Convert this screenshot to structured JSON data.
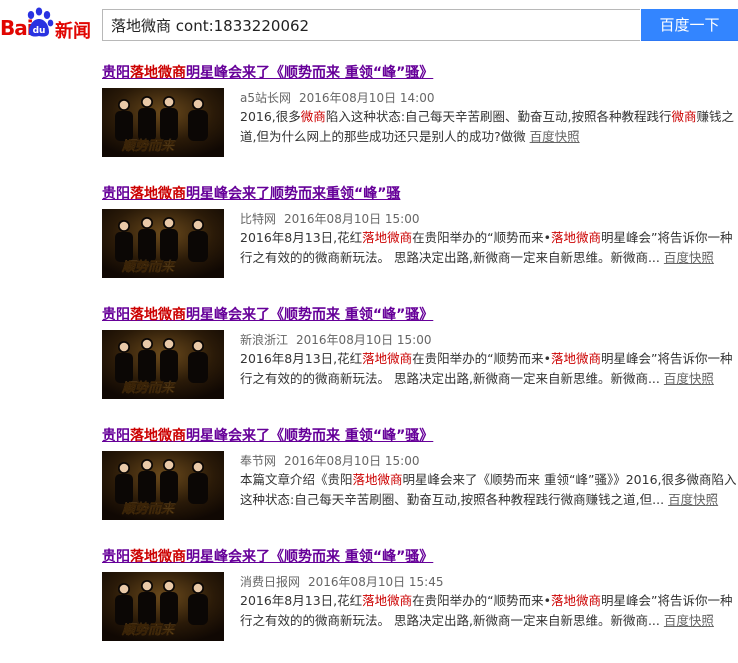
{
  "header": {
    "logo_bai": "Bai",
    "logo_du": "du",
    "logo_news": "新闻",
    "search_value": "落地微商 cont:1833220062",
    "search_button": "百度一下"
  },
  "thumb_text": "顺势而来",
  "results": [
    {
      "title": [
        {
          "t": "贵阳",
          "h": false
        },
        {
          "t": "落地微商",
          "h": true
        },
        {
          "t": "明星峰会来了《顺势而来 重领“峰”骚》",
          "h": false
        }
      ],
      "source": "a5站长网",
      "date": "2016年08月10日 14:00",
      "snippet": [
        {
          "t": "2016,很多",
          "h": false
        },
        {
          "t": "微商",
          "h": true
        },
        {
          "t": "陷入这种状态:自己每天辛苦刷圈、勤奋互动,按照各种教程践行",
          "h": false
        },
        {
          "t": "微商",
          "h": true
        },
        {
          "t": "赚钱之道,但为什么网上的那些成功还只是别人的成功?做微",
          "h": false
        }
      ],
      "cache": "百度快照"
    },
    {
      "title": [
        {
          "t": "贵阳",
          "h": false
        },
        {
          "t": "落地微商",
          "h": true
        },
        {
          "t": "明星峰会来了顺势而来重领“峰”骚",
          "h": false
        }
      ],
      "source": "比特网",
      "date": "2016年08月10日 15:00",
      "snippet": [
        {
          "t": "2016年8月13日,花红",
          "h": false
        },
        {
          "t": "落地微商",
          "h": true
        },
        {
          "t": "在贵阳举办的“顺势而来•",
          "h": false
        },
        {
          "t": "落地微商",
          "h": true
        },
        {
          "t": "明星峰会”将告诉你一种行之有效的的微商新玩法。 思路决定出路,新微商一定来自新思维。新微商...",
          "h": false
        }
      ],
      "cache": "百度快照"
    },
    {
      "title": [
        {
          "t": "贵阳",
          "h": false
        },
        {
          "t": "落地微商",
          "h": true
        },
        {
          "t": "明星峰会来了《顺势而来 重领“峰”骚》",
          "h": false
        }
      ],
      "source": "新浪浙江",
      "date": "2016年08月10日 15:00",
      "snippet": [
        {
          "t": "2016年8月13日,花红",
          "h": false
        },
        {
          "t": "落地微商",
          "h": true
        },
        {
          "t": "在贵阳举办的“顺势而来•",
          "h": false
        },
        {
          "t": "落地微商",
          "h": true
        },
        {
          "t": "明星峰会”将告诉你一种行之有效的的微商新玩法。 思路决定出路,新微商一定来自新思维。新微商...",
          "h": false
        }
      ],
      "cache": "百度快照"
    },
    {
      "title": [
        {
          "t": "贵阳",
          "h": false
        },
        {
          "t": "落地微商",
          "h": true
        },
        {
          "t": "明星峰会来了《顺势而来 重领“峰”骚》",
          "h": false
        }
      ],
      "source": "奉节网",
      "date": "2016年08月10日 15:00",
      "snippet": [
        {
          "t": "本篇文章介绍《贵阳",
          "h": false
        },
        {
          "t": "落地微商",
          "h": true
        },
        {
          "t": "明星峰会来了《顺势而来 重领“峰”骚》》2016,很多微商陷入这种状态:自己每天辛苦刷圈、勤奋互动,按照各种教程践行微商赚钱之道,但...",
          "h": false
        }
      ],
      "cache": "百度快照"
    },
    {
      "title": [
        {
          "t": "贵阳",
          "h": false
        },
        {
          "t": "落地微商",
          "h": true
        },
        {
          "t": "明星峰会来了《顺势而来 重领“峰”骚》",
          "h": false
        }
      ],
      "source": "消费日报网",
      "date": "2016年08月10日 15:45",
      "snippet": [
        {
          "t": "2016年8月13日,花红",
          "h": false
        },
        {
          "t": "落地微商",
          "h": true
        },
        {
          "t": "在贵阳举办的“顺势而来•",
          "h": false
        },
        {
          "t": "落地微商",
          "h": true
        },
        {
          "t": "明星峰会”将告诉你一种行之有效的的微商新玩法。 思路决定出路,新微商一定来自新思维。新微商...",
          "h": false
        }
      ],
      "cache": "百度快照"
    }
  ]
}
